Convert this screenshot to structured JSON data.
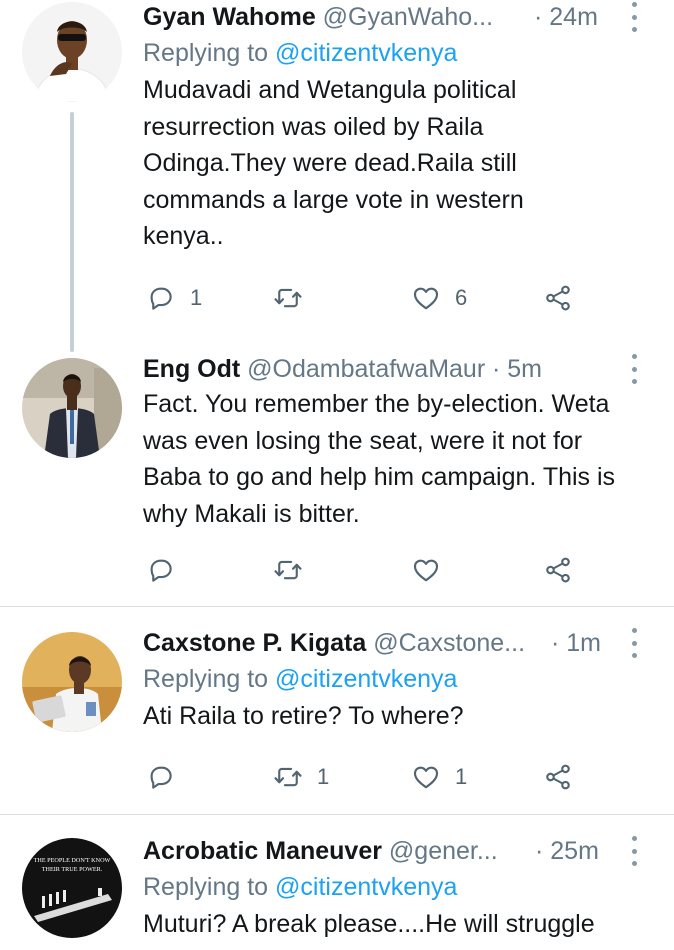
{
  "tweets": [
    {
      "name": "Gyan Wahome",
      "handle": "@GyanWaho...",
      "time": "· 24m",
      "replying_label": "Replying to",
      "replying_to": "@citizentvkenya",
      "text": "Mudavadi and Wetangula political resurrection was oiled by Raila Odinga.They were dead.Raila still commands a large vote in western kenya..",
      "replies": "1",
      "retweets": "",
      "likes": "6"
    },
    {
      "name": "Eng Odt",
      "handle": "@OdambatafwaMaur",
      "time": "· 5m",
      "text": "Fact. You remember the by-election. Weta was even losing the seat, were it not for Baba to go and help him campaign. This is why Makali is bitter.",
      "replies": "",
      "retweets": "",
      "likes": ""
    },
    {
      "name": "Caxstone P. Kigata",
      "handle": "@Caxstone...",
      "time": "· 1m",
      "replying_label": "Replying to",
      "replying_to": "@citizentvkenya",
      "text": "Ati Raila to retire? To where?",
      "replies": "",
      "retweets": "1",
      "likes": "1"
    },
    {
      "name": "Acrobatic Maneuver",
      "handle": "@gener...",
      "time": "· 25m",
      "replying_label": "Replying to",
      "replying_to": "@citizentvkenya",
      "text": "Muturi? A break please....He will struggle",
      "avatar_caption": "THE PEOPLE DON'T KNOW THEIR TRUE POWER."
    }
  ],
  "colors": {
    "text": "#14171a",
    "secondary": "#657786",
    "link": "#1da1f2",
    "divider": "#d9dde1",
    "thread_line": "#c4cfd6"
  },
  "icons": [
    "reply-icon",
    "retweet-icon",
    "like-icon",
    "share-icon",
    "more-icon"
  ]
}
